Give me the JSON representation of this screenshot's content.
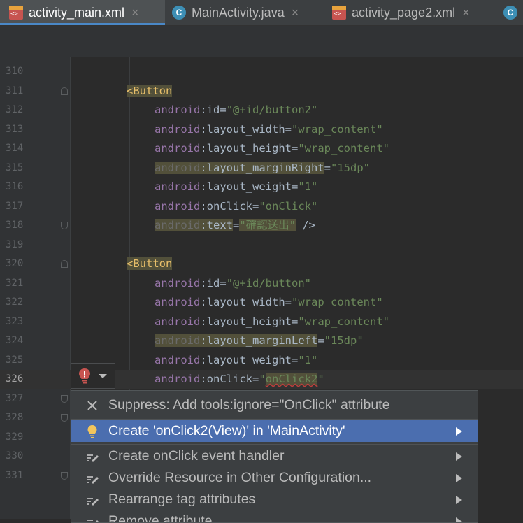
{
  "tabs": [
    {
      "label": "activity_main.xml",
      "icon": "xml-file-icon",
      "active": true
    },
    {
      "label": "MainActivity.java",
      "icon": "class-icon",
      "active": false
    },
    {
      "label": "activity_page2.xml",
      "icon": "xml-file-icon",
      "active": false
    },
    {
      "label": "",
      "icon": "class-icon",
      "active": false
    }
  ],
  "tab_close_glyph": "×",
  "tab_class_letter": "C",
  "xml_icon_text": "<>",
  "editor": {
    "current_line": "326",
    "lines": [
      {
        "num": "310"
      },
      {
        "num": "311",
        "open": "<",
        "tag": "Button"
      },
      {
        "num": "312",
        "ns": "android",
        "colon": ":",
        "attr": "id",
        "eq": "=",
        "value": "\"@+id/button2\""
      },
      {
        "num": "313",
        "ns": "android",
        "colon": ":",
        "attr": "layout_width",
        "eq": "=",
        "value": "\"wrap_content\""
      },
      {
        "num": "314",
        "ns": "android",
        "colon": ":",
        "attr": "layout_height",
        "eq": "=",
        "value": "\"wrap_content\""
      },
      {
        "num": "315",
        "ns": "android",
        "colon": ":",
        "attr": "layout_marginRight",
        "eq": "=",
        "value": "\"15dp\""
      },
      {
        "num": "316",
        "ns": "android",
        "colon": ":",
        "attr": "layout_weight",
        "eq": "=",
        "value": "\"1\""
      },
      {
        "num": "317",
        "ns": "android",
        "colon": ":",
        "attr": "onClick",
        "eq": "=",
        "value": "\"onClick\""
      },
      {
        "num": "318",
        "ns": "android",
        "colon": ":",
        "attr": "text",
        "eq": "=",
        "value": "\"確認送出\"",
        "close": " />"
      },
      {
        "num": "319"
      },
      {
        "num": "320",
        "open": "<",
        "tag": "Button"
      },
      {
        "num": "321",
        "ns": "android",
        "colon": ":",
        "attr": "id",
        "eq": "=",
        "value": "\"@+id/button\""
      },
      {
        "num": "322",
        "ns": "android",
        "colon": ":",
        "attr": "layout_width",
        "eq": "=",
        "value": "\"wrap_content\""
      },
      {
        "num": "323",
        "ns": "android",
        "colon": ":",
        "attr": "layout_height",
        "eq": "=",
        "value": "\"wrap_content\""
      },
      {
        "num": "324",
        "ns": "android",
        "colon": ":",
        "attr": "layout_marginLeft",
        "eq": "=",
        "value": "\"15dp\""
      },
      {
        "num": "325",
        "ns": "android",
        "colon": ":",
        "attr": "layout_weight",
        "eq": "=",
        "value": "\"1\""
      },
      {
        "num": "326",
        "ns": "android",
        "colon": ":",
        "attr": "onClick",
        "eq": "=",
        "q1": "\"",
        "value_inner": "onClick2",
        "q2": "\""
      },
      {
        "num": "327"
      },
      {
        "num": "328"
      },
      {
        "num": "329"
      },
      {
        "num": "330"
      },
      {
        "num": "331"
      }
    ]
  },
  "intention_menu": {
    "items": [
      {
        "label": "Suppress: Add tools:ignore=\"OnClick\" attribute",
        "icon": "close-icon",
        "submenu": false
      },
      {
        "label": "Create 'onClick2(View)' in 'MainActivity'",
        "icon": "lightbulb-icon",
        "submenu": true,
        "selected": true
      },
      {
        "label": "Create onClick event handler",
        "icon": "edit-icon",
        "submenu": true
      },
      {
        "label": "Override Resource in Other Configuration...",
        "icon": "edit-icon",
        "submenu": true
      },
      {
        "label": "Rearrange tag attributes",
        "icon": "edit-icon",
        "submenu": true
      },
      {
        "label": "Remove attribute",
        "icon": "edit-icon",
        "submenu": true
      }
    ]
  },
  "colors": {
    "selection": "#4b6eaf",
    "tag": "#e8bf6a",
    "attribute": "#9876aa",
    "string": "#6a8759",
    "error": "#c75450"
  }
}
